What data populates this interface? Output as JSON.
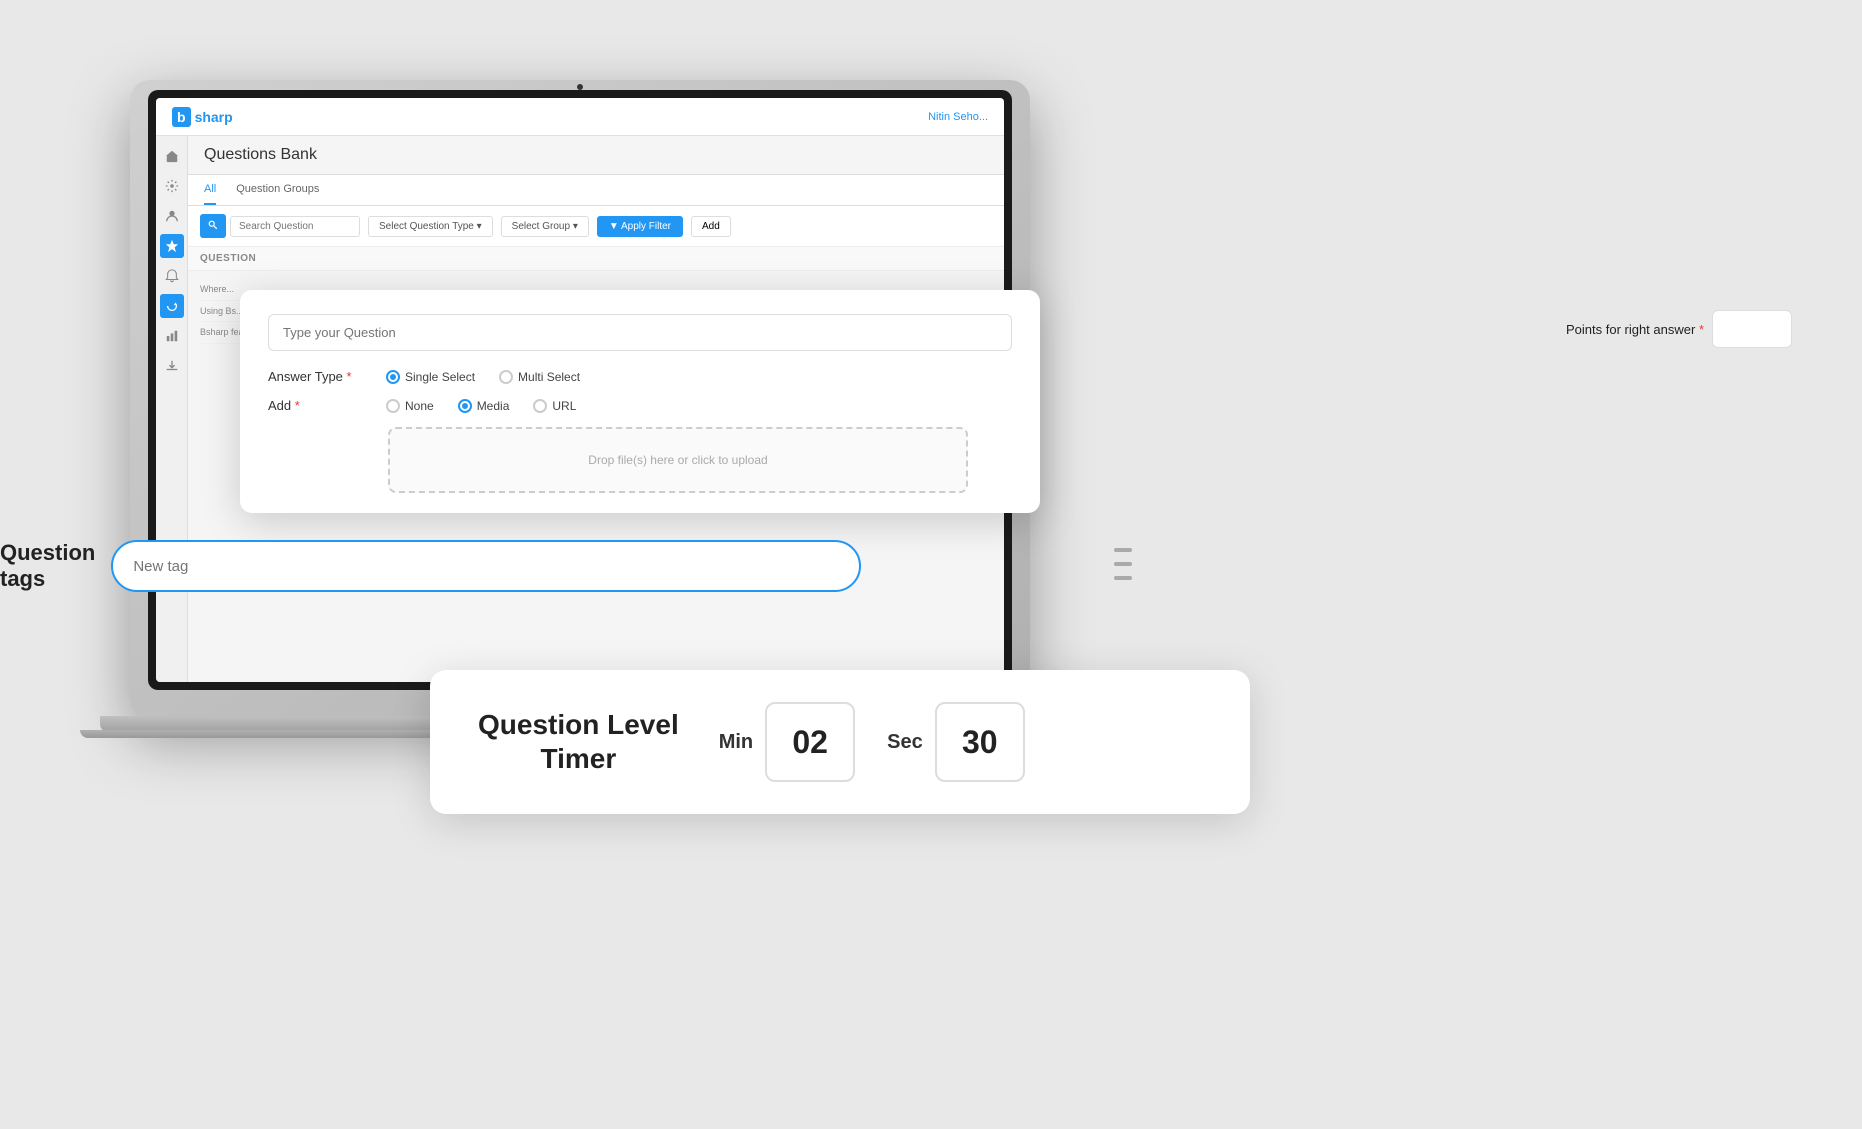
{
  "app": {
    "brand": {
      "b": "b",
      "name": "sharp"
    },
    "header_user": "Nitin Seho..."
  },
  "page": {
    "title": "Questions Bank",
    "tabs": [
      {
        "label": "All",
        "active": true
      },
      {
        "label": "Question Groups",
        "active": false
      }
    ]
  },
  "filter": {
    "search_placeholder": "Search Question",
    "question_type_label": "Select Question Type ▾",
    "group_label": "Select Group ▾",
    "apply_filter_label": "▼ Apply Filter",
    "add_label": "Add"
  },
  "table": {
    "column_question": "QUESTION"
  },
  "question_form": {
    "placeholder": "Type your Question",
    "answer_type_label": "Answer Type",
    "add_label": "Add",
    "answer_options": [
      {
        "label": "Single Select",
        "checked": true
      },
      {
        "label": "Multi Select",
        "checked": false
      }
    ],
    "add_options": [
      {
        "label": "None",
        "checked": false
      },
      {
        "label": "Media",
        "checked": true
      },
      {
        "label": "URL",
        "checked": false
      }
    ],
    "upload_text": "Drop file(s) here or click to upload"
  },
  "points": {
    "label": "Points for right answer",
    "value": ""
  },
  "question_tags": {
    "label_line1": "Question",
    "label_line2": "tags",
    "placeholder": "New tag"
  },
  "timer": {
    "title_line1": "Question Level",
    "title_line2": "Timer",
    "min_label": "Min",
    "sec_label": "Sec",
    "min_value": "02",
    "sec_value": "30"
  },
  "sidebar": {
    "items": [
      {
        "name": "home",
        "active": false
      },
      {
        "name": "settings",
        "active": false
      },
      {
        "name": "users",
        "active": false
      },
      {
        "name": "star",
        "active": true
      },
      {
        "name": "bell",
        "active": false
      },
      {
        "name": "refresh",
        "active": true
      },
      {
        "name": "chart",
        "active": false
      },
      {
        "name": "download",
        "active": false
      }
    ]
  }
}
